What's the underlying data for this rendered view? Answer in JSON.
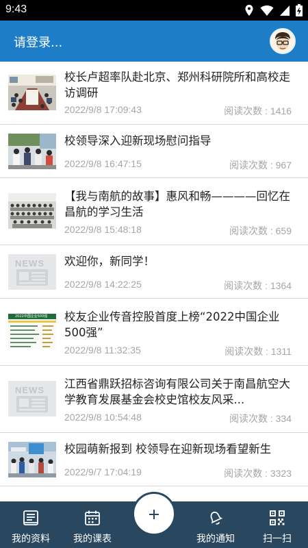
{
  "status_bar": {
    "time": "9:43"
  },
  "app_bar": {
    "login_text": "请登录..."
  },
  "news": [
    {
      "title": "校长卢超率队赴北京、郑州科研院所和高校走访调研",
      "date": "2022/9/8 17:09:43",
      "reads": "阅读次数 : 1416"
    },
    {
      "title": "校领导深入迎新现场慰问指导",
      "date": "2022/9/8 16:47:15",
      "reads": "阅读次数 : 967"
    },
    {
      "title": "【我与南航的故事】惠风和畅————回忆在昌航的学习生活",
      "date": "2022/9/8 15:48:18",
      "reads": "阅读次数 : 659"
    },
    {
      "title": "欢迎你，新同学！",
      "date": "2022/9/8 14:22:25",
      "reads": "阅读次数 : 1364",
      "placeholder_word": "NEWS"
    },
    {
      "title": "校友企业传音控股首度上榜“2022中国企业500强”",
      "date": "2022/9/8 11:32:35",
      "reads": "阅读次数 : 1311",
      "thumb_caption": "2022中国企业500强"
    },
    {
      "title": "江西省鼎跃招标咨询有限公司关于南昌航空大学教育发展基金会校史馆校友风采...",
      "date": "2022/9/8 10:54:48",
      "reads": "阅读次数 : 334",
      "placeholder_word": "NEWS"
    },
    {
      "title": "校园萌新报到 校领导在迎新现场看望新生",
      "date": "2022/9/7 17:04:19",
      "reads": "阅读次数 : 3323"
    }
  ],
  "bottom_nav": {
    "profile": "我的资料",
    "schedule": "我的课表",
    "notices": "我的通知",
    "scan": "扫一扫"
  },
  "colors": {
    "app_bar": "#1d7dc7",
    "bottom_nav": "#29475f",
    "meta_text": "#a5a5a5"
  }
}
